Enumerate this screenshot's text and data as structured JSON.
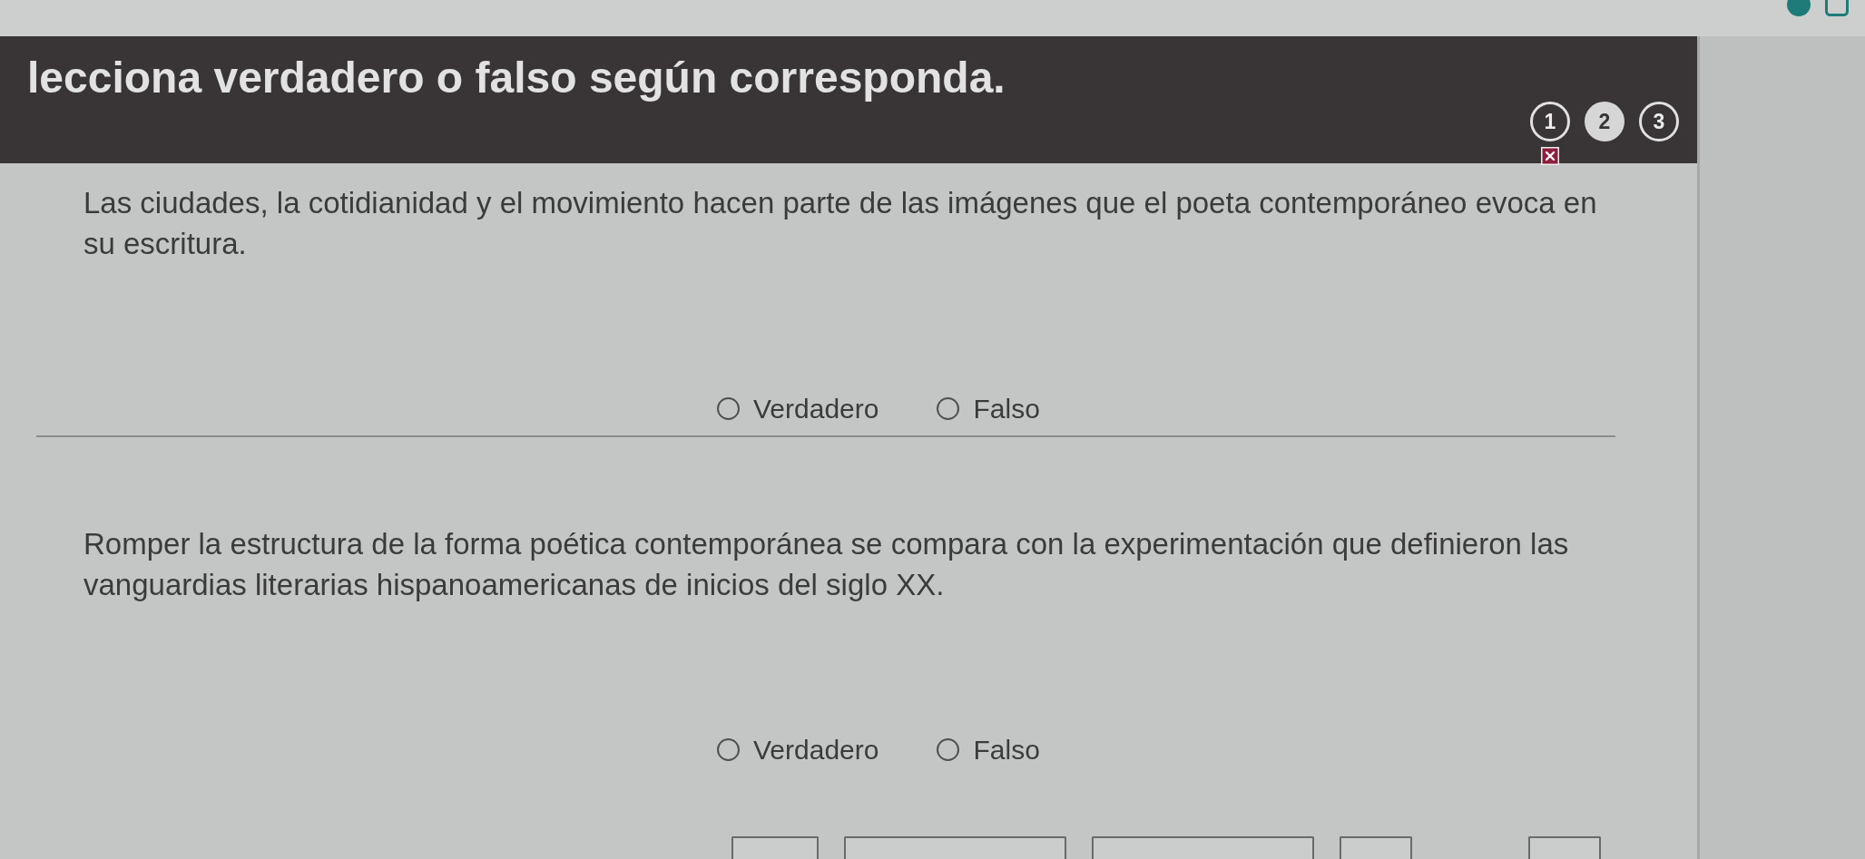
{
  "header": {
    "title": "lecciona verdadero o falso según corresponda.",
    "steps": [
      {
        "label": "1",
        "selected": false,
        "wrong": true
      },
      {
        "label": "2",
        "selected": true,
        "wrong": false
      },
      {
        "label": "3",
        "selected": false,
        "wrong": false
      }
    ]
  },
  "questions": [
    {
      "text": "Las ciudades, la cotidianidad y el movimiento hacen parte de las imágenes que el poeta contemporáneo evoca en su escritura.",
      "options": [
        {
          "label": "Verdadero",
          "selected": false
        },
        {
          "label": "Falso",
          "selected": false
        }
      ]
    },
    {
      "text": "Romper la estructura de la forma poética contemporánea se compara con la experimentación que definieron las vanguardias literarias hispanoamericanas de inicios del siglo XX.",
      "options": [
        {
          "label": "Verdadero",
          "selected": false
        },
        {
          "label": "Falso",
          "selected": false
        }
      ]
    }
  ]
}
